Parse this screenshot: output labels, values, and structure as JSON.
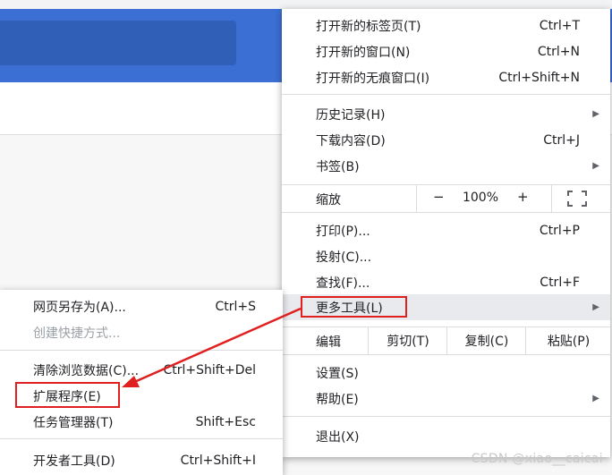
{
  "main_menu": {
    "items": [
      {
        "label": "打开新的标签页(T)",
        "shortcut": "Ctrl+T"
      },
      {
        "label": "打开新的窗口(N)",
        "shortcut": "Ctrl+N"
      },
      {
        "label": "打开新的无痕窗口(I)",
        "shortcut": "Ctrl+Shift+N"
      },
      {
        "label": "历史记录(H)",
        "shortcut": ""
      },
      {
        "label": "下载内容(D)",
        "shortcut": "Ctrl+J"
      },
      {
        "label": "书签(B)",
        "shortcut": ""
      },
      {
        "label": "打印(P)...",
        "shortcut": "Ctrl+P"
      },
      {
        "label": "投射(C)...",
        "shortcut": ""
      },
      {
        "label": "查找(F)...",
        "shortcut": "Ctrl+F"
      },
      {
        "label": "更多工具(L)",
        "shortcut": ""
      },
      {
        "label": "设置(S)",
        "shortcut": ""
      },
      {
        "label": "帮助(E)",
        "shortcut": ""
      },
      {
        "label": "退出(X)",
        "shortcut": ""
      }
    ],
    "zoom": {
      "label": "缩放",
      "minus": "−",
      "value": "100%",
      "plus": "+"
    },
    "edit": {
      "label": "编辑",
      "cut": "剪切(T)",
      "copy": "复制(C)",
      "paste": "粘贴(P)"
    }
  },
  "submenu": {
    "items": [
      {
        "label": "网页另存为(A)...",
        "shortcut": "Ctrl+S"
      },
      {
        "label": "创建快捷方式...",
        "shortcut": ""
      },
      {
        "label": "清除浏览数据(C)...",
        "shortcut": "Ctrl+Shift+Del"
      },
      {
        "label": "扩展程序(E)",
        "shortcut": ""
      },
      {
        "label": "任务管理器(T)",
        "shortcut": "Shift+Esc"
      },
      {
        "label": "开发者工具(D)",
        "shortcut": "Ctrl+Shift+I"
      }
    ]
  },
  "watermark": "CSDN @xiao__caicai",
  "icons": {
    "submenu_arrow": "chevron-right-icon",
    "fullscreen": "fullscreen-icon",
    "annotation_arrow": "red-arrow-icon"
  },
  "colors": {
    "toolbar": "#3b6fd3",
    "highlight": "#e8eaed",
    "annotation": "#e02020"
  }
}
